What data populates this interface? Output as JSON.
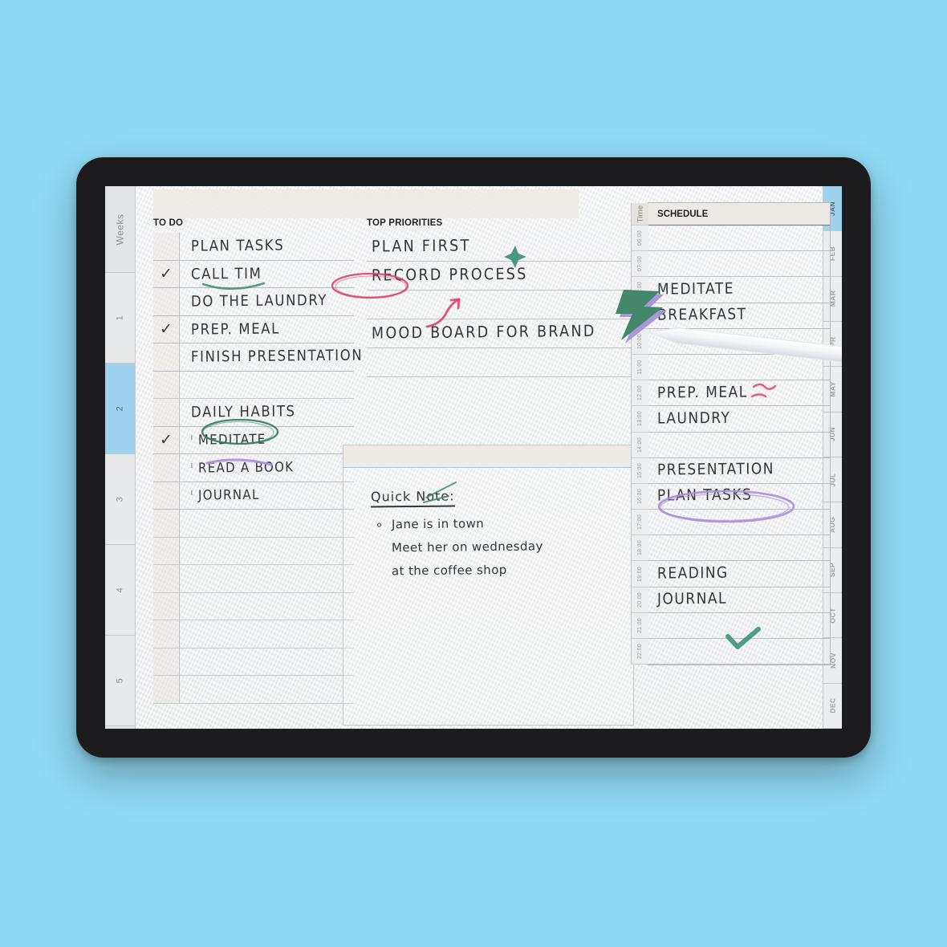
{
  "device": {
    "name": "tablet",
    "frame_color": "#1c1c1e",
    "background_color": "#8fd9f2"
  },
  "rails": {
    "weeks_label": "Weeks",
    "weeks": [
      {
        "label": "1",
        "active": false
      },
      {
        "label": "2",
        "active": true
      },
      {
        "label": "3",
        "active": false
      },
      {
        "label": "4",
        "active": false
      },
      {
        "label": "5",
        "active": false
      }
    ],
    "months": [
      {
        "label": "JAN",
        "active": true
      },
      {
        "label": "FEB",
        "active": false
      },
      {
        "label": "MAR",
        "active": false
      },
      {
        "label": "APR",
        "active": false
      },
      {
        "label": "MAY",
        "active": false
      },
      {
        "label": "JUN",
        "active": false
      },
      {
        "label": "JUL",
        "active": false
      },
      {
        "label": "AUG",
        "active": false
      },
      {
        "label": "SEP",
        "active": false
      },
      {
        "label": "OCT",
        "active": false
      },
      {
        "label": "NOV",
        "active": false
      },
      {
        "label": "DEC",
        "active": false
      }
    ]
  },
  "todo": {
    "header": "TO DO",
    "rows": [
      {
        "text": "PLAN TASKS",
        "checked": false,
        "sub": false,
        "mark": null
      },
      {
        "text": "CALL  TIM",
        "checked": true,
        "sub": false,
        "mark": "green-underline"
      },
      {
        "text": "DO THE LAUNDRY",
        "checked": false,
        "sub": false,
        "mark": null
      },
      {
        "text": "PREP.  MEAL",
        "checked": true,
        "sub": false,
        "mark": null
      },
      {
        "text": "FINISH PRESENTATION",
        "checked": false,
        "sub": false,
        "mark": null
      },
      {
        "text": "",
        "checked": false,
        "sub": false,
        "mark": null
      },
      {
        "text": "DAILY HABITS",
        "checked": false,
        "sub": false,
        "mark": "green-circle-habits"
      },
      {
        "text": "MEDITATE",
        "checked": true,
        "sub": true,
        "mark": "purple-underline"
      },
      {
        "text": "READ A BOOK",
        "checked": false,
        "sub": true,
        "mark": null
      },
      {
        "text": "JOURNAL",
        "checked": false,
        "sub": true,
        "mark": null
      },
      {
        "text": "",
        "checked": false,
        "sub": false,
        "mark": null
      },
      {
        "text": "",
        "checked": false,
        "sub": false,
        "mark": null
      },
      {
        "text": "",
        "checked": false,
        "sub": false,
        "mark": null
      },
      {
        "text": "",
        "checked": false,
        "sub": false,
        "mark": null
      },
      {
        "text": "",
        "checked": false,
        "sub": false,
        "mark": null
      },
      {
        "text": "",
        "checked": false,
        "sub": false,
        "mark": null
      },
      {
        "text": "",
        "checked": false,
        "sub": false,
        "mark": null
      }
    ],
    "check_glyph": "✓",
    "sub_glyph": "ˡ"
  },
  "priorities": {
    "header": "TOP PRIORITIES",
    "rows": [
      {
        "text": "PLAN  FIRST",
        "mark": "green-star"
      },
      {
        "text": "RECORD  PROCESS",
        "mark": "pink-circle-record"
      },
      {
        "text": "",
        "mark": "pink-arrow"
      },
      {
        "text": "MOOD BOARD FOR  BRAND",
        "mark": "lightning-sticker"
      },
      {
        "text": "",
        "mark": null
      }
    ]
  },
  "note": {
    "title": "Quick Note:",
    "lines": [
      "Jane is in town",
      "Meet her on wednesday",
      "at the coffee shop"
    ],
    "bullet_mark": "green-strike"
  },
  "schedule": {
    "header": "SCHEDULE",
    "time_label": "Time",
    "rows": [
      {
        "time": "06:00",
        "text": "",
        "mark": null
      },
      {
        "time": "07:00",
        "text": "",
        "mark": null
      },
      {
        "time": "08:00",
        "text": "MEDITATE",
        "mark": null
      },
      {
        "time": "09:00",
        "text": "BREAKFAST",
        "mark": null
      },
      {
        "time": "10:00",
        "text": "",
        "mark": null
      },
      {
        "time": "11:00",
        "text": "",
        "mark": null
      },
      {
        "time": "12:00",
        "text": "PREP. MEAL",
        "mark": "pink-squiggle"
      },
      {
        "time": "13:00",
        "text": "LAUNDRY",
        "mark": null
      },
      {
        "time": "14:00",
        "text": "",
        "mark": null
      },
      {
        "time": "15:00",
        "text": "PRESENTATION",
        "mark": "purple-circle"
      },
      {
        "time": "16:00",
        "text": "PLAN TASKS",
        "mark": null
      },
      {
        "time": "17:00",
        "text": "",
        "mark": null
      },
      {
        "time": "18:00",
        "text": "",
        "mark": null
      },
      {
        "time": "19:00",
        "text": "READING",
        "mark": null
      },
      {
        "time": "20:00",
        "text": "JOURNAL",
        "mark": "green-check"
      },
      {
        "time": "21:00",
        "text": "",
        "mark": null
      },
      {
        "time": "22:00",
        "text": "",
        "mark": null
      }
    ]
  },
  "accents": {
    "green": "#3f8a6e",
    "pink": "#d9436e",
    "purple": "#a98fd8",
    "tab_blue": "#9ed2ee",
    "rule_blue": "#a8c8e2",
    "ink": "#34373a"
  },
  "stylus": {
    "name": "apple-pencil",
    "color": "#f2f3f6"
  }
}
